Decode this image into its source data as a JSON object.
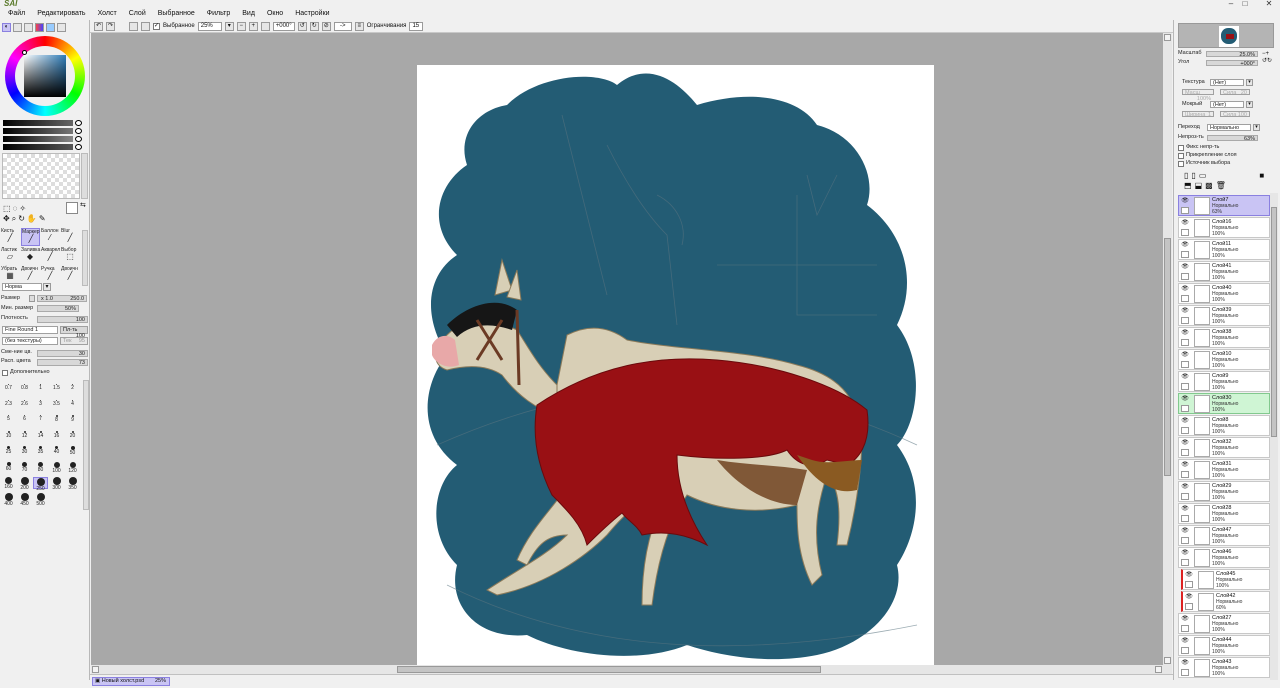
{
  "app": {
    "logo": "SAI"
  },
  "window": {
    "minimize": "–",
    "maximize": "□",
    "close": "✕"
  },
  "menu": [
    "Файл",
    "Редактировать",
    "Холст",
    "Слой",
    "Выбранное",
    "Фильтр",
    "Вид",
    "Окно",
    "Настройки"
  ],
  "toolbar": {
    "selection_label": "Выбранное",
    "zoom": "25%",
    "angle": "+000°",
    "flip": "->",
    "stabilizer_label": "Огранчивания",
    "stabilizer_value": "15"
  },
  "left": {
    "tools": [
      {
        "label": "Кисть",
        "icon": "brush-icon"
      },
      {
        "label": "Маркер",
        "icon": "marker-icon",
        "active": true
      },
      {
        "label": "Баллон",
        "icon": "airbrush-icon"
      },
      {
        "label": "Blur",
        "icon": "blur-icon"
      },
      {
        "label": "Ластик",
        "icon": "eraser-icon"
      },
      {
        "label": "Заливка",
        "icon": "bucket-icon"
      },
      {
        "label": "Акварел",
        "icon": "watercolor-icon"
      },
      {
        "label": "Выбор",
        "icon": "select-icon"
      },
      {
        "label": "Убрать",
        "icon": "deselect-icon"
      },
      {
        "label": "Двоичн",
        "icon": "binary-pen-icon"
      },
      {
        "label": "Ручка",
        "icon": "pen-icon"
      },
      {
        "label": "Двоичн",
        "icon": "binary-eraser-icon"
      }
    ],
    "blend_mode": "Норма",
    "size_label": "Размер",
    "size_mult": "x 1.0",
    "size_value": "250.0",
    "min_size_label": "Мин. размер",
    "min_size_value": "50%",
    "density_label": "Плотность",
    "density_value": "100",
    "brush_shape": "Fine Round 1",
    "brush_shape_strength_label": "Пл-ть",
    "brush_shape_strength": "100",
    "texture": "(без текстуры)",
    "texture_strength_label": "Тек",
    "texture_strength": "95",
    "blend_label": "Сме-ние цв.",
    "blend_value": "30",
    "dilution_label": "Расп. цвета",
    "dilution_value": "73",
    "advanced_label": "Дополнительно",
    "brush_sizes": [
      "0.7",
      "0.8",
      "1",
      "1.5",
      "2",
      "2.3",
      "2.6",
      "3",
      "3.5",
      "4",
      "5",
      "6",
      "7",
      "8",
      "9",
      "10",
      "12",
      "14",
      "16",
      "20",
      "25",
      "30",
      "35",
      "40",
      "50",
      "60",
      "70",
      "80",
      "100",
      "120",
      "160",
      "200",
      "250",
      "300",
      "350",
      "400",
      "450",
      "500"
    ],
    "selected_brush_size": "250"
  },
  "right": {
    "zoom_label": "Масштаб",
    "zoom_value": "25.0%",
    "angle_label": "Угол",
    "angle_value": "+000°",
    "texture_label": "Текстура",
    "texture_value": "(Нет)",
    "texture_scale_label": "Масш",
    "texture_scale": "100%",
    "texture_strength_label": "Сила",
    "texture_strength": "20",
    "effect_label": "Мокрый",
    "effect_value": "(Нет)",
    "effect_width_label": "Ширина",
    "effect_width": "1",
    "effect_strength_label": "Сила",
    "effect_strength": "100",
    "mode_label": "Переход",
    "mode_value": "Нормально",
    "opacity_label": "Непроз-ть",
    "opacity_value": "63%",
    "checks": [
      "Фикс непр-ть",
      "Прикрепление слоя",
      "Источник выбора"
    ],
    "layers": [
      {
        "name": "Слой7",
        "mode": "Нормально",
        "opacity": "63%",
        "selected": true
      },
      {
        "name": "Слой16",
        "mode": "Нормально",
        "opacity": "100%"
      },
      {
        "name": "Слой11",
        "mode": "Нормально",
        "opacity": "100%"
      },
      {
        "name": "Слой41",
        "mode": "Нормально",
        "opacity": "100%"
      },
      {
        "name": "Слой40",
        "mode": "Нормально",
        "opacity": "100%"
      },
      {
        "name": "Слой39",
        "mode": "Нормально",
        "opacity": "100%"
      },
      {
        "name": "Слой38",
        "mode": "Нормально",
        "opacity": "100%"
      },
      {
        "name": "Слой10",
        "mode": "Нормально",
        "opacity": "100%"
      },
      {
        "name": "Слой9",
        "mode": "Нормально",
        "opacity": "100%"
      },
      {
        "name": "Слой30",
        "mode": "Нормально",
        "opacity": "100%",
        "highlight": true
      },
      {
        "name": "Слой8",
        "mode": "Нормально",
        "opacity": "100%"
      },
      {
        "name": "Слой32",
        "mode": "Нормально",
        "opacity": "100%"
      },
      {
        "name": "Слой31",
        "mode": "Нормально",
        "opacity": "100%"
      },
      {
        "name": "Слой29",
        "mode": "Нормально",
        "opacity": "100%"
      },
      {
        "name": "Слой28",
        "mode": "Нормально",
        "opacity": "100%"
      },
      {
        "name": "Слой47",
        "mode": "Нормально",
        "opacity": "100%"
      },
      {
        "name": "Слой46",
        "mode": "Нормально",
        "opacity": "100%"
      },
      {
        "name": "Слой45",
        "mode": "Нормально",
        "opacity": "100%",
        "clipped": true
      },
      {
        "name": "Слой42",
        "mode": "Нормально",
        "opacity": "60%",
        "clipped": true
      },
      {
        "name": "Слой27",
        "mode": "Нормально",
        "opacity": "100%"
      },
      {
        "name": "Слой44",
        "mode": "Нормально",
        "opacity": "100%"
      },
      {
        "name": "Слой43",
        "mode": "Нормально",
        "opacity": "100%"
      }
    ]
  },
  "status": {
    "document": "Новый холст.psd",
    "zoom": "25%"
  }
}
